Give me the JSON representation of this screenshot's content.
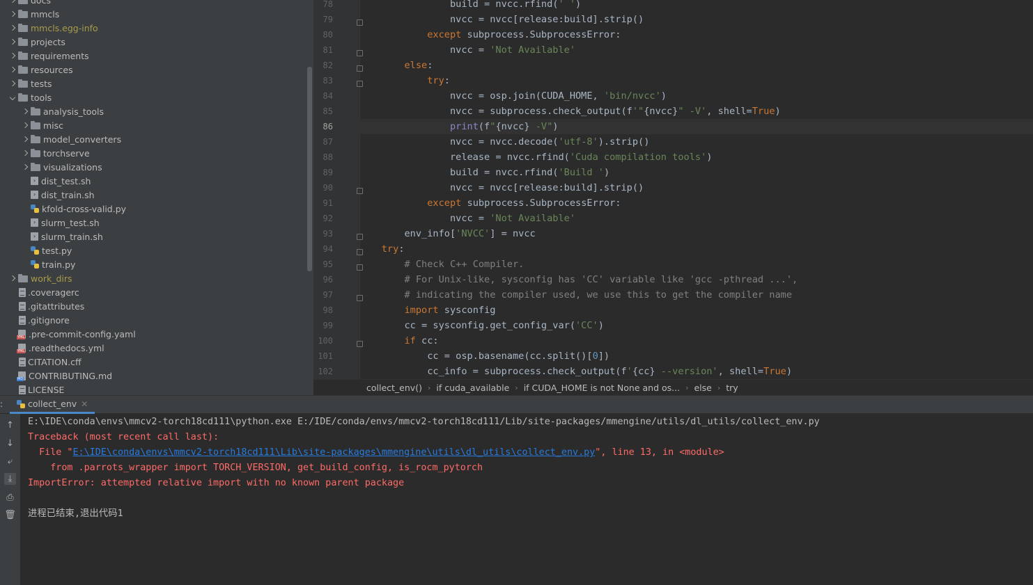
{
  "project_tree": {
    "items": [
      {
        "label": "docs",
        "type": "folder",
        "depth": 0,
        "expanded": false
      },
      {
        "label": "mmcls",
        "type": "folder",
        "depth": 0,
        "expanded": false
      },
      {
        "label": "mmcls.egg-info",
        "type": "folder",
        "depth": 0,
        "expanded": false,
        "ignored": true
      },
      {
        "label": "projects",
        "type": "folder",
        "depth": 0,
        "expanded": false
      },
      {
        "label": "requirements",
        "type": "folder",
        "depth": 0,
        "expanded": false
      },
      {
        "label": "resources",
        "type": "folder",
        "depth": 0,
        "expanded": false
      },
      {
        "label": "tests",
        "type": "folder",
        "depth": 0,
        "expanded": false
      },
      {
        "label": "tools",
        "type": "folder",
        "depth": 0,
        "expanded": true
      },
      {
        "label": "analysis_tools",
        "type": "folder",
        "depth": 1,
        "expanded": false
      },
      {
        "label": "misc",
        "type": "folder",
        "depth": 1,
        "expanded": false
      },
      {
        "label": "model_converters",
        "type": "folder",
        "depth": 1,
        "expanded": false
      },
      {
        "label": "torchserve",
        "type": "folder",
        "depth": 1,
        "expanded": false
      },
      {
        "label": "visualizations",
        "type": "folder",
        "depth": 1,
        "expanded": false
      },
      {
        "label": "dist_test.sh",
        "type": "sh",
        "depth": 1
      },
      {
        "label": "dist_train.sh",
        "type": "sh",
        "depth": 1
      },
      {
        "label": "kfold-cross-valid.py",
        "type": "py",
        "depth": 1
      },
      {
        "label": "slurm_test.sh",
        "type": "sh",
        "depth": 1
      },
      {
        "label": "slurm_train.sh",
        "type": "sh",
        "depth": 1
      },
      {
        "label": "test.py",
        "type": "py",
        "depth": 1
      },
      {
        "label": "train.py",
        "type": "py",
        "depth": 1
      },
      {
        "label": "work_dirs",
        "type": "folder",
        "depth": 0,
        "expanded": false,
        "ignored": true
      },
      {
        "label": ".coveragerc",
        "type": "file",
        "depth": 0
      },
      {
        "label": ".gitattributes",
        "type": "file",
        "depth": 0
      },
      {
        "label": ".gitignore",
        "type": "file",
        "depth": 0
      },
      {
        "label": ".pre-commit-config.yaml",
        "type": "yml",
        "depth": 0
      },
      {
        "label": ".readthedocs.yml",
        "type": "yml",
        "depth": 0
      },
      {
        "label": "CITATION.cff",
        "type": "file",
        "depth": 0
      },
      {
        "label": "CONTRIBUTING.md",
        "type": "md",
        "depth": 0
      },
      {
        "label": "LICENSE",
        "type": "file",
        "depth": 0
      }
    ]
  },
  "editor": {
    "current_line": 86,
    "lines": [
      {
        "n": "78",
        "fold": false,
        "code": [
          [
            "",
            "                build = nvcc.rfind("
          ],
          [
            "str",
            "' '"
          ],
          [
            "",
            ")"
          ]
        ]
      },
      {
        "n": "79",
        "fold": true,
        "code": [
          [
            "",
            "                nvcc = nvcc[release:build].strip()"
          ]
        ]
      },
      {
        "n": "80",
        "fold": false,
        "code": [
          [
            "",
            "            "
          ],
          [
            "kw",
            "except "
          ],
          [
            "",
            "subprocess.SubprocessError:"
          ]
        ]
      },
      {
        "n": "81",
        "fold": true,
        "code": [
          [
            "",
            "                nvcc = "
          ],
          [
            "str",
            "'Not Available'"
          ]
        ]
      },
      {
        "n": "82",
        "fold": true,
        "code": [
          [
            "",
            "        "
          ],
          [
            "kw",
            "else"
          ],
          [
            "",
            ":"
          ]
        ]
      },
      {
        "n": "83",
        "fold": true,
        "code": [
          [
            "",
            "            "
          ],
          [
            "kw",
            "try"
          ],
          [
            "",
            ":"
          ]
        ]
      },
      {
        "n": "84",
        "fold": false,
        "code": [
          [
            "",
            "                nvcc = osp.join(CUDA_HOME, "
          ],
          [
            "str",
            "'bin/nvcc'"
          ],
          [
            "",
            ")"
          ]
        ]
      },
      {
        "n": "85",
        "fold": false,
        "code": [
          [
            "",
            "                nvcc = subprocess.check_output(f"
          ],
          [
            "str",
            "'\""
          ],
          [
            "",
            "{nvcc}"
          ],
          [
            "str",
            "\" -V'"
          ],
          [
            "",
            ", shell="
          ],
          [
            "kw",
            "True"
          ],
          [
            "",
            ")"
          ]
        ]
      },
      {
        "n": "86",
        "fold": false,
        "code": [
          [
            "",
            "                "
          ],
          [
            "bi",
            "print"
          ],
          [
            "",
            "(f"
          ],
          [
            "str",
            "\""
          ],
          [
            "",
            "{nvcc}"
          ],
          [
            "str",
            " -V\""
          ],
          [
            "",
            ")"
          ]
        ]
      },
      {
        "n": "87",
        "fold": false,
        "code": [
          [
            "",
            "                nvcc = nvcc.decode("
          ],
          [
            "str",
            "'utf-8'"
          ],
          [
            "",
            ").strip()"
          ]
        ]
      },
      {
        "n": "88",
        "fold": false,
        "code": [
          [
            "",
            "                release = nvcc.rfind("
          ],
          [
            "str",
            "'Cuda compilation tools'"
          ],
          [
            "",
            ")"
          ]
        ]
      },
      {
        "n": "89",
        "fold": false,
        "code": [
          [
            "",
            "                build = nvcc.rfind("
          ],
          [
            "str",
            "'Build '"
          ],
          [
            "",
            ")"
          ]
        ]
      },
      {
        "n": "90",
        "fold": true,
        "code": [
          [
            "",
            "                nvcc = nvcc[release:build].strip()"
          ]
        ]
      },
      {
        "n": "91",
        "fold": false,
        "code": [
          [
            "",
            "            "
          ],
          [
            "kw",
            "except "
          ],
          [
            "",
            "subprocess.SubprocessError:"
          ]
        ]
      },
      {
        "n": "92",
        "fold": false,
        "code": [
          [
            "",
            "                nvcc = "
          ],
          [
            "str",
            "'Not Available'"
          ]
        ]
      },
      {
        "n": "93",
        "fold": true,
        "code": [
          [
            "",
            "        env_info["
          ],
          [
            "str",
            "'NVCC'"
          ],
          [
            "",
            "] = nvcc"
          ]
        ]
      },
      {
        "n": "94",
        "fold": true,
        "code": [
          [
            "",
            "    "
          ],
          [
            "kw",
            "try"
          ],
          [
            "",
            ":"
          ]
        ]
      },
      {
        "n": "95",
        "fold": true,
        "code": [
          [
            "",
            "        "
          ],
          [
            "cm",
            "# Check C++ Compiler."
          ]
        ]
      },
      {
        "n": "96",
        "fold": false,
        "code": [
          [
            "",
            "        "
          ],
          [
            "cm",
            "# For Unix-like, sysconfig has 'CC' variable like 'gcc -pthread ...',"
          ]
        ]
      },
      {
        "n": "97",
        "fold": true,
        "code": [
          [
            "",
            "        "
          ],
          [
            "cm",
            "# indicating the compiler used, we use this to get the compiler name"
          ]
        ]
      },
      {
        "n": "98",
        "fold": false,
        "code": [
          [
            "",
            "        "
          ],
          [
            "kw",
            "import "
          ],
          [
            "",
            "sysconfig"
          ]
        ]
      },
      {
        "n": "99",
        "fold": false,
        "code": [
          [
            "",
            "        cc = sysconfig.get_config_var("
          ],
          [
            "str",
            "'CC'"
          ],
          [
            "",
            ")"
          ]
        ]
      },
      {
        "n": "100",
        "fold": true,
        "code": [
          [
            "",
            "        "
          ],
          [
            "kw",
            "if "
          ],
          [
            "",
            "cc:"
          ]
        ]
      },
      {
        "n": "101",
        "fold": false,
        "code": [
          [
            "",
            "            cc = osp.basename(cc.split()["
          ],
          [
            "num",
            "0"
          ],
          [
            "",
            "])"
          ]
        ]
      },
      {
        "n": "102",
        "fold": false,
        "code": [
          [
            "",
            "            cc_info = subprocess.check_output(f"
          ],
          [
            "str",
            "'"
          ],
          [
            "",
            "{cc}"
          ],
          [
            "str",
            " --version'"
          ],
          [
            "",
            ", shell="
          ],
          [
            "kw",
            "True"
          ],
          [
            "",
            ")"
          ]
        ]
      }
    ]
  },
  "breadcrumb": [
    "collect_env()",
    "if cuda_available",
    "if CUDA_HOME is not None and os...",
    "else",
    "try"
  ],
  "run_panel": {
    "tab_label": "collect_env",
    "colon": ":",
    "lines": [
      {
        "type": "normal",
        "text": "E:\\IDE\\conda\\envs\\mmcv2-torch18cd111\\python.exe E:/IDE/conda/envs/mmcv2-torch18cd111/Lib/site-packages/mmengine/utils/dl_utils/collect_env.py"
      },
      {
        "type": "err",
        "text": "Traceback (most recent call last):"
      },
      {
        "type": "file",
        "prefix": "  File \"",
        "link": "E:\\IDE\\conda\\envs\\mmcv2-torch18cd111\\Lib\\site-packages\\mmengine\\utils\\dl_utils\\collect_env.py",
        "suffix": "\", line 13, in <module>"
      },
      {
        "type": "err",
        "text": "    from .parrots_wrapper import TORCH_VERSION, get_build_config, is_rocm_pytorch"
      },
      {
        "type": "err",
        "text": "ImportError: attempted relative import with no known parent package"
      },
      {
        "type": "normal",
        "text": ""
      },
      {
        "type": "normal",
        "text": "进程已结束,退出代码1"
      }
    ]
  },
  "colors": {
    "keyword": "#cc7832",
    "string": "#6a8759",
    "comment": "#808080",
    "error": "#ff6b68",
    "link": "#287bde"
  }
}
